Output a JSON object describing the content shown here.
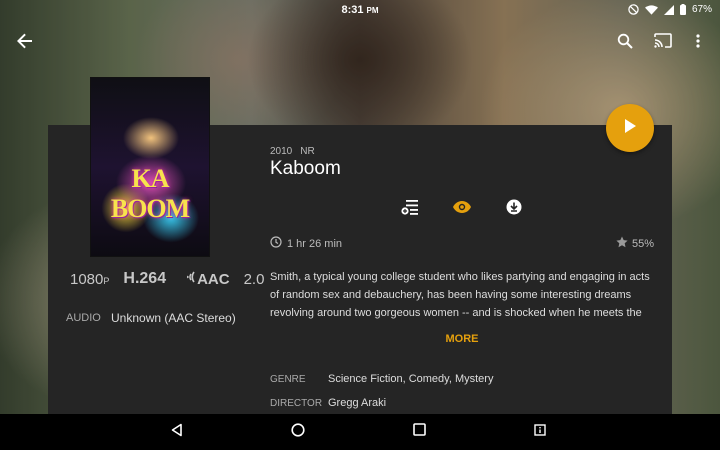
{
  "status_bar": {
    "time": "8:31",
    "time_suffix": "PM",
    "battery": "67%",
    "icons": [
      "do-not-disturb-icon",
      "wifi-icon",
      "signal-icon",
      "battery-icon"
    ]
  },
  "app_bar": {
    "icons": [
      "back-arrow-icon",
      "search-icon",
      "cast-icon",
      "more-vert-icon"
    ]
  },
  "movie": {
    "poster_text": "KA BOOM",
    "year": "2010",
    "content_rating": "NR",
    "title": "Kaboom",
    "duration": "1 hr 26 min",
    "rating": "55%",
    "summary": "Smith, a typical young college student who likes partying and engaging in acts of random sex and debauchery, has been having some interesting dreams revolving around two gorgeous women -- and is shocked when he meets the dream girls in",
    "more_label": "MORE"
  },
  "media_info": {
    "resolution": "1080",
    "resolution_suffix": "P",
    "video_codec": "H.264",
    "audio_codec": "AAC",
    "channels": "2.0",
    "audio_label": "AUDIO",
    "audio_value": "Unknown (AAC Stereo)"
  },
  "details": {
    "genre_label": "GENRE",
    "genre_value": "Science Fiction, Comedy, Mystery",
    "director_label": "DIRECTOR",
    "director_value": "Gregg Araki"
  },
  "actions": [
    "add-to-playlist-icon",
    "watched-eye-icon",
    "download-icon"
  ],
  "colors": {
    "accent": "#e5a00d",
    "card_background": "#252525",
    "nav_background": "#000000"
  }
}
